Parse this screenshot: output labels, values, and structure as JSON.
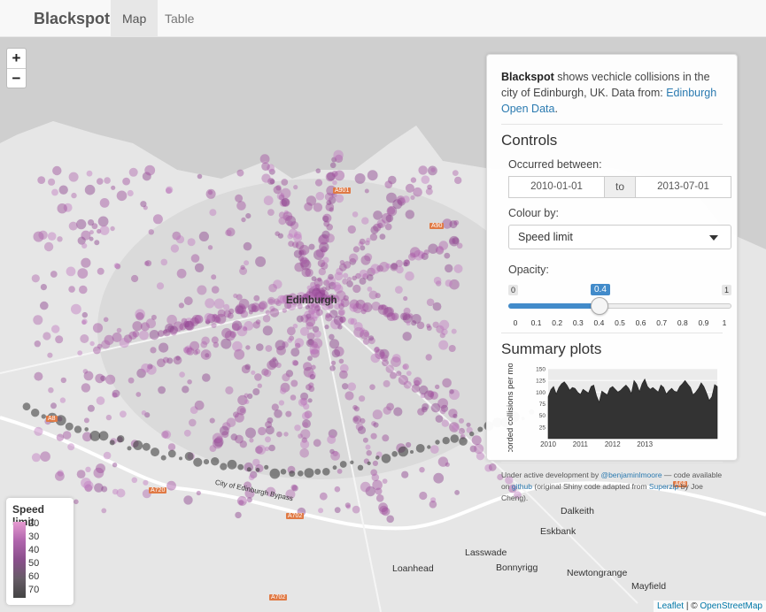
{
  "navbar": {
    "brand": "Blackspot",
    "tabs": [
      {
        "label": "Map",
        "active": true
      },
      {
        "label": "Table",
        "active": false
      }
    ]
  },
  "zoom": {
    "in_label": "+",
    "out_label": "−"
  },
  "panel": {
    "intro_bold": "Blackspot",
    "intro_text": " shows vechicle collisions in the city of Edinburgh, UK. Data from: ",
    "intro_link": "Edinburgh Open Data",
    "intro_end": ".",
    "controls_heading": "Controls",
    "occurred_label": "Occurred between:",
    "date_from": "2010-01-01",
    "date_sep": "to",
    "date_to": "2013-07-01",
    "colour_label": "Colour by:",
    "colour_value": "Speed limit",
    "opacity_label": "Opacity:",
    "opacity": {
      "min": "0",
      "max": "1",
      "value": "0.4",
      "value_fraction": 0.4,
      "ticks": [
        "0",
        "0.1",
        "0.2",
        "0.3",
        "0.4",
        "0.5",
        "0.6",
        "0.7",
        "0.8",
        "0.9",
        "1"
      ]
    },
    "summary_heading": "Summary plots",
    "footer": {
      "t1": "Under active development by ",
      "l1": "@benjaminlmoore",
      "t2": " — code available on ",
      "l2": "github",
      "t3": " (original Shiny code adapted from ",
      "l3": "Superzip",
      "t4": " by Joe Cheng)."
    }
  },
  "chart_data": {
    "type": "area",
    "ylabel": "Recorded collisions per month",
    "x_ticks": [
      "2010",
      "2011",
      "2012",
      "2013"
    ],
    "x_start": 2010.0,
    "x_step_months": 1,
    "y_ticks": [
      "25",
      "50",
      "75",
      "100",
      "125",
      "150"
    ],
    "ylim": [
      0,
      150
    ],
    "values": [
      90,
      105,
      112,
      96,
      110,
      118,
      122,
      115,
      104,
      110,
      108,
      100,
      95,
      106,
      102,
      98,
      112,
      115,
      92,
      78,
      102,
      98,
      94,
      108,
      112,
      106,
      100,
      104,
      110,
      115,
      108,
      97,
      125,
      117,
      101,
      118,
      128,
      112,
      106,
      110,
      105,
      100,
      115,
      110,
      96,
      103,
      108,
      102,
      100,
      112,
      118,
      125,
      117,
      110,
      94,
      100,
      108,
      120,
      112,
      98,
      82,
      90,
      116,
      112
    ]
  },
  "legend": {
    "title": "Speed limit",
    "labels": [
      "20",
      "30",
      "40",
      "50",
      "60",
      "70"
    ],
    "colors": [
      "#e59ad0",
      "#b065ad",
      "#8a4f8c",
      "#665c66",
      "#444444"
    ]
  },
  "map_labels": {
    "edinburgh": "Edinburgh",
    "dalkeith": "Dalkeith",
    "eskbank": "Eskbank",
    "lasswade": "Lasswade",
    "loanhead": "Loanhead",
    "bonnyrigg": "Bonnyrigg",
    "newtongrange": "Newtongrange",
    "mayfield": "Mayfield",
    "bypass": "City of Edinburgh Bypass",
    "a720": "A720",
    "a702": "A702",
    "a68": "A68",
    "a901": "A901",
    "a90": "A90",
    "a8": "A8",
    "a702b": "A702"
  },
  "attribution": {
    "leaflet": "Leaflet",
    "sep": " | © ",
    "osm": "OpenStreetMap"
  }
}
